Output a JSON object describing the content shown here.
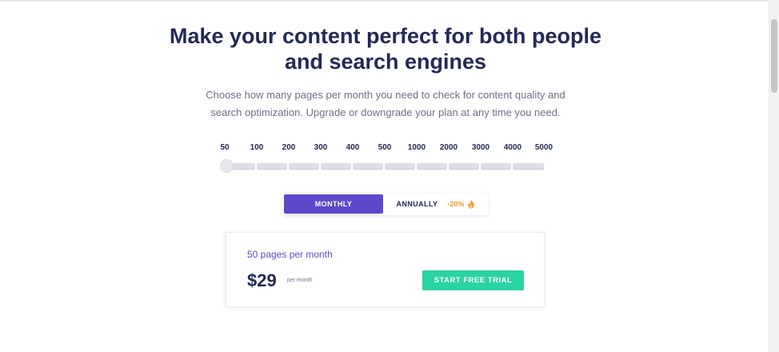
{
  "hero": {
    "title": "Make your content perfect for both people and search engines",
    "subtitle": "Choose how many pages per month you need to check for content quality and search optimization. Upgrade or downgrade your plan at any time you need."
  },
  "slider": {
    "ticks": [
      "50",
      "100",
      "200",
      "300",
      "400",
      "500",
      "1000",
      "2000",
      "3000",
      "4000",
      "5000"
    ],
    "selected": "50"
  },
  "billing_toggle": {
    "monthly_label": "MONTHLY",
    "annually_label": "ANNUALLY",
    "annual_discount": "-20%",
    "discount_icon": "fire-icon",
    "selected": "monthly"
  },
  "plan": {
    "pages_label": "50 pages per month",
    "price": "$29",
    "period": "per month",
    "cta_label": "START FREE TRIAL"
  },
  "colors": {
    "heading": "#242a55",
    "accent_purple": "#5c48c9",
    "cta_green": "#2ad3a3",
    "discount_orange": "#f29a3a"
  }
}
